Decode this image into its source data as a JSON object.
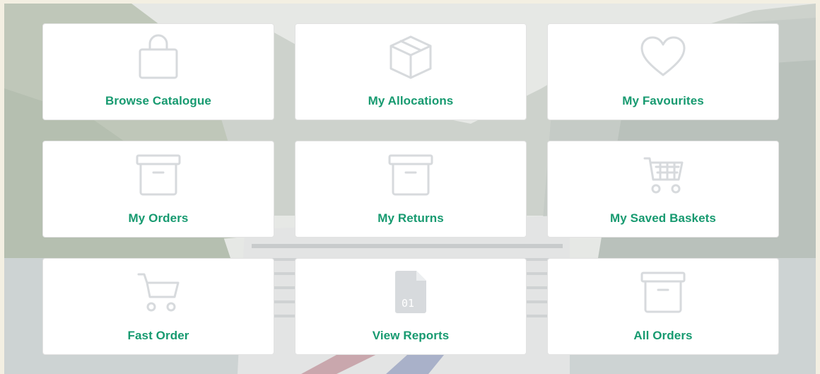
{
  "colors": {
    "accent": "#179a70",
    "icon": "#d7dadd",
    "tile_bg": "#ffffff",
    "page_bg": "#f3efe2"
  },
  "tiles": [
    {
      "label": "Browse Catalogue",
      "icon": "shopping-bag-icon"
    },
    {
      "label": "My Allocations",
      "icon": "box-icon"
    },
    {
      "label": "My Favourites",
      "icon": "heart-icon"
    },
    {
      "label": "My Orders",
      "icon": "archive-box-icon"
    },
    {
      "label": "My Returns",
      "icon": "archive-box-icon"
    },
    {
      "label": "My Saved Baskets",
      "icon": "shopping-basket-icon"
    },
    {
      "label": "Fast Order",
      "icon": "shopping-cart-icon"
    },
    {
      "label": "View Reports",
      "icon": "data-file-icon",
      "icon_text": "01"
    },
    {
      "label": "All Orders",
      "icon": "archive-box-icon"
    }
  ]
}
